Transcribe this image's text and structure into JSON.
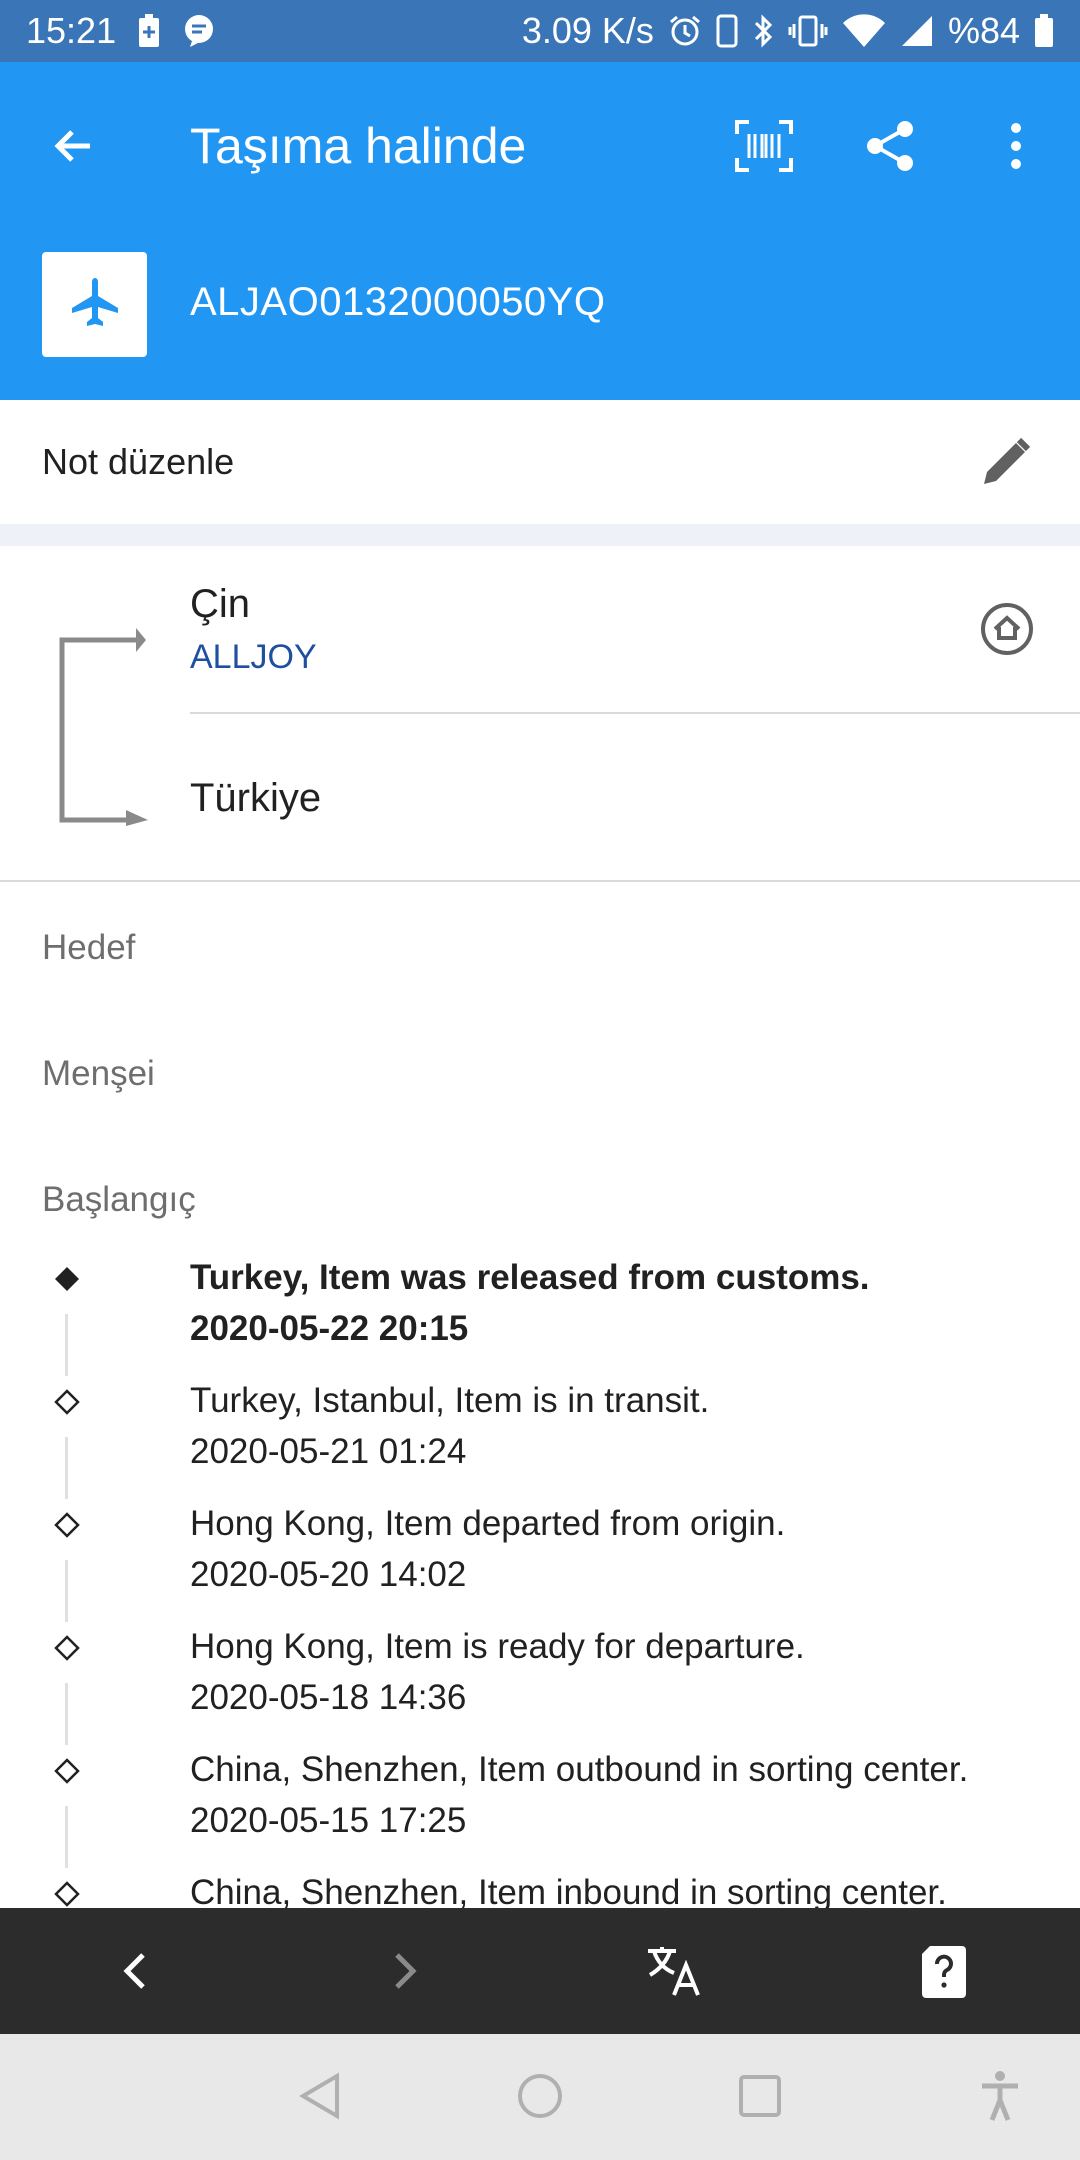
{
  "status_bar": {
    "time": "15:21",
    "net_speed": "3.09 K/s",
    "battery": "%84",
    "left_icons": [
      "battery-saver-icon",
      "chat-notification-icon"
    ],
    "right_icons": [
      "alarm-icon",
      "phone-portrait-icon",
      "bluetooth-icon",
      "vibrate-icon",
      "wifi-icon",
      "cell-signal-icon",
      "battery-icon"
    ]
  },
  "app_bar": {
    "title": "Taşıma halinde",
    "tracking_number": "ALJAO0132000050YQ",
    "mode_icon": "airplane-icon",
    "actions": [
      "barcode-icon",
      "share-icon",
      "more-vert-icon"
    ],
    "color": "#2196F3"
  },
  "note": {
    "label": "Not düzenle"
  },
  "route": {
    "origin": "Çin",
    "carrier": "ALLJOY",
    "destination": "Türkiye"
  },
  "sections": {
    "destination_label": "Hedef",
    "origin_label": "Menşei",
    "start_label": "Başlangıç"
  },
  "events": [
    {
      "description": "Turkey, Item was released from customs.",
      "datetime": "2020-05-22 20:15"
    },
    {
      "description": "Turkey, Istanbul, Item is in transit.",
      "datetime": "2020-05-21 01:24"
    },
    {
      "description": "Hong Kong, Item departed from origin.",
      "datetime": "2020-05-20 14:02"
    },
    {
      "description": "Hong Kong, Item is ready for departure.",
      "datetime": "2020-05-18 14:36"
    },
    {
      "description": "China, Shenzhen, Item outbound in sorting center.",
      "datetime": "2020-05-15 17:25"
    },
    {
      "description": "China, Shenzhen, Item inbound in sorting center.",
      "datetime": ""
    }
  ],
  "toolbar": {
    "items": [
      "chevron-left-icon",
      "chevron-right-icon",
      "translate-icon",
      "help-icon"
    ]
  },
  "nav_bar": {
    "items": [
      "nav-back-icon",
      "nav-home-icon",
      "nav-recents-icon",
      "accessibility-icon"
    ]
  }
}
